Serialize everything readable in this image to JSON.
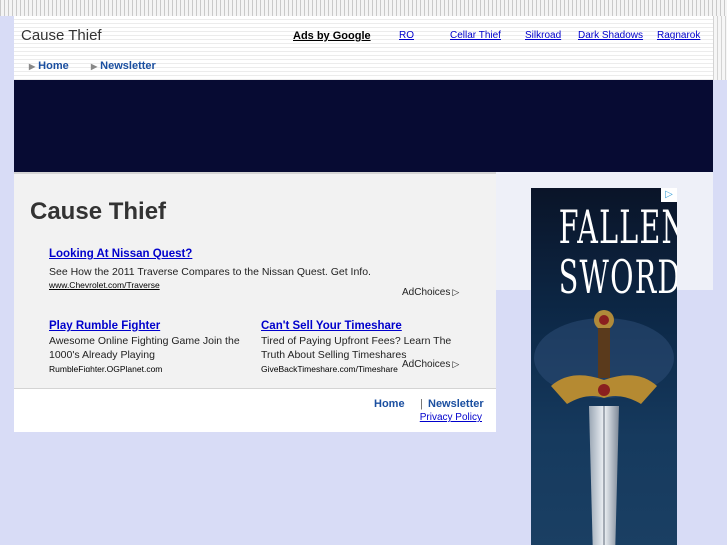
{
  "header": {
    "site_title": "Cause Thief",
    "ads_label": "Ads by Google",
    "ad_links": [
      "RO",
      "Cellar Thief",
      "Silkroad",
      "Dark Shadows",
      "Ragnarok"
    ]
  },
  "nav": {
    "items": [
      "Home",
      "Newsletter"
    ]
  },
  "main": {
    "title": "Cause Thief",
    "ads": [
      {
        "title": "Looking At Nissan Quest?",
        "desc": "See How the 2011 Traverse Compares to the Nissan Quest. Get Info.",
        "url": "www.Chevrolet.com/Traverse"
      },
      {
        "title": "Play Rumble Fighter",
        "desc_lines": [
          "Awesome Online Fighting Game Join the",
          "1000's Already Playing"
        ],
        "url": "RumbleFighter.OGPlanet.com"
      },
      {
        "title": "Can't Sell Your Timeshare",
        "desc_lines": [
          "Tired of Paying Upfront Fees? Learn The",
          "Truth About Selling Timeshares"
        ],
        "url": "GiveBackTimeshare.com/Timeshare"
      }
    ],
    "adchoices_label": "AdChoices"
  },
  "footer": {
    "links": [
      "Home",
      "Newsletter"
    ],
    "separator": "|",
    "privacy": "Privacy Policy"
  },
  "skyscraper_ad": {
    "line1": "FALLEN",
    "line2": "SWORD"
  },
  "colors": {
    "banner": "#070b33",
    "page_bg": "#d8dcf6",
    "link": "#0000cc",
    "nav_link": "#1b4fa0"
  }
}
